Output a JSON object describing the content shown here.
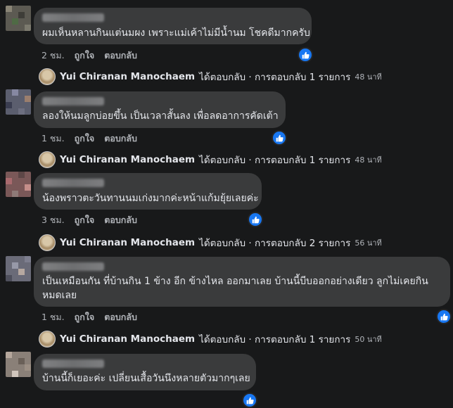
{
  "comments": [
    {
      "text": "ผมเห็นหลานกินแต่นมผง เพราะแม่เค้าไม่มีน้ำนม โชคดีมากครับ",
      "time": "2 ชม.",
      "like": "ถูกใจ",
      "reply": "ตอบกลับ",
      "replies": {
        "name": "Yui Chiranan Manochaem",
        "action": "ได้ตอบกลับ · การตอบกลับ 1 รายการ",
        "time": "48 นาที"
      }
    },
    {
      "text": "ลองให้นมลูกบ่อยขึ้น เป็นเวลาสั้นลง เพื่อลดอาการคัดเต้า",
      "time": "1 ชม.",
      "like": "ถูกใจ",
      "reply": "ตอบกลับ",
      "replies": {
        "name": "Yui Chiranan Manochaem",
        "action": "ได้ตอบกลับ · การตอบกลับ 1 รายการ",
        "time": "48 นาที"
      }
    },
    {
      "text": "น้องพราวตะวันทานนมเก่งมากค่ะหน้าแก้มยุ้ยเลยค่ะ",
      "time": "3 ชม.",
      "like": "ถูกใจ",
      "reply": "ตอบกลับ",
      "replies": {
        "name": "Yui Chiranan Manochaem",
        "action": "ได้ตอบกลับ · การตอบกลับ 2 รายการ",
        "time": "56 นาที"
      }
    },
    {
      "text": "เป็นเหมือนกัน ที่บ้านกิน 1 ข้าง อีก ข้างไหล ออกมาเลย บ้านนี้บีบออกอย่างเดียว ลูกไม่เคยกินหมดเลย",
      "time": "1 ชม.",
      "like": "ถูกใจ",
      "reply": "ตอบกลับ",
      "replies": {
        "name": "Yui Chiranan Manochaem",
        "action": "ได้ตอบกลับ · การตอบกลับ 1 รายการ",
        "time": "50 นาที"
      }
    },
    {
      "text": "บ้านนี้ก็เยอะค่ะ เปลี่ยนเสื้อวันนึงหลายตัวมากๆเลย",
      "time": "",
      "like": "",
      "reply": ""
    }
  ],
  "colors": {
    "background": "#18191a",
    "bubble": "#3a3b3c",
    "like_badge": "#1877f2",
    "secondary_text": "#b0b3b8"
  },
  "icons": {
    "like_badge": "thumbs-up-icon",
    "avatar": "blurred-avatar"
  }
}
